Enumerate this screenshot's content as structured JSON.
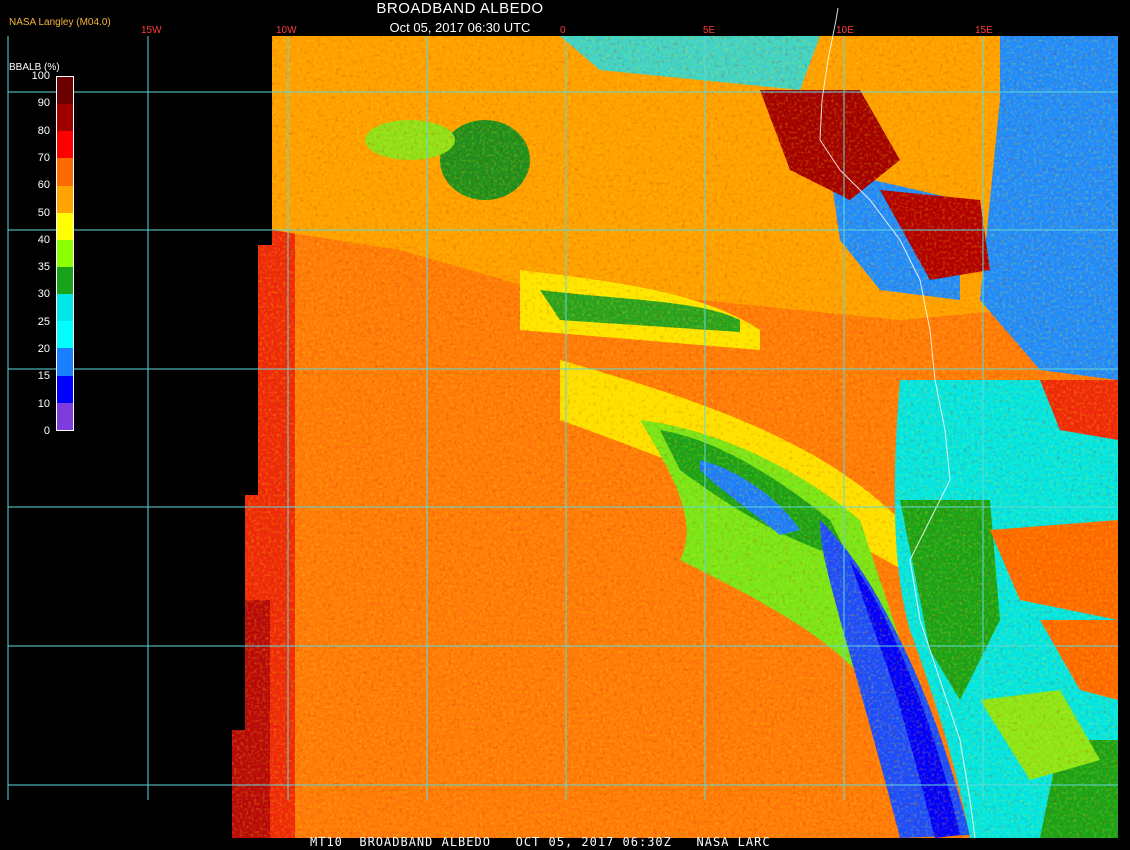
{
  "title": {
    "main": "BROADBAND ALBEDO",
    "datetime": "Oct 05, 2017 06:30 UTC"
  },
  "producer": "NASA Langley (M04.0)",
  "legend": {
    "title": "BBALB (%)",
    "ticks": [
      "100",
      "90",
      "80",
      "70",
      "60",
      "50",
      "40",
      "35",
      "30",
      "25",
      "20",
      "15",
      "10",
      "0"
    ],
    "colors": [
      "#6b0000",
      "#a00000",
      "#ff0000",
      "#ff6a00",
      "#ffa400",
      "#ffff00",
      "#8cff00",
      "#1aa31a",
      "#00e6e6",
      "#00ffff",
      "#1a7fff",
      "#0000ff",
      "#7f3cdc"
    ]
  },
  "longitude_labels": [
    "15W",
    "10W",
    "0",
    "5E",
    "10E",
    "15E"
  ],
  "footer": "MT10  BROADBAND ALBEDO   OCT 05, 2017 06:30Z   NASA LARC",
  "map": {
    "grid_color": "#66dddd",
    "coastline_color": "#ffffff"
  }
}
